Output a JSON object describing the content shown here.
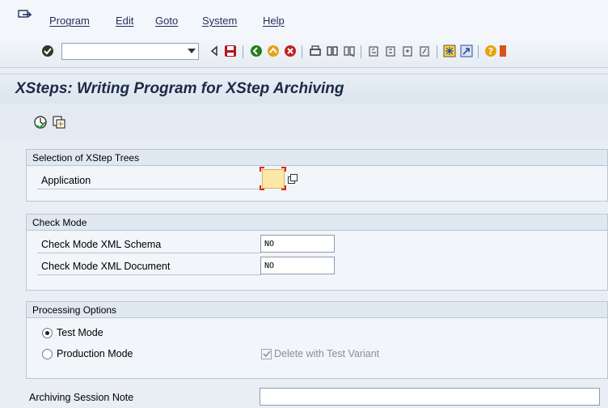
{
  "menu": {
    "items": [
      {
        "label": "Program"
      },
      {
        "label": "Edit"
      },
      {
        "label": "Goto"
      },
      {
        "label": "System"
      },
      {
        "label": "Help"
      }
    ]
  },
  "toolbar": {
    "command_value": "",
    "icons": [
      "enter-icon",
      "back-icon",
      "save-icon",
      "back-nav-icon",
      "exit-icon",
      "cancel-icon",
      "print-icon",
      "find-icon",
      "find-next-icon",
      "first-page-icon",
      "previous-page-icon",
      "next-page-icon",
      "last-page-icon",
      "create-session-icon",
      "shortcut-icon",
      "help-icon",
      "customize-layout-icon"
    ]
  },
  "title": {
    "text": "XSteps: Writing Program for XStep Archiving"
  },
  "app_toolbar": {
    "icons": [
      "execute-icon",
      "get-variant-icon"
    ]
  },
  "selection_frame": {
    "heading": "Selection of XStep Trees",
    "application_label": "Application",
    "application_value": ""
  },
  "check_mode_frame": {
    "heading": "Check Mode",
    "schema_label": "Check Mode XML Schema",
    "schema_value": "NO",
    "document_label": "Check Mode XML Document",
    "document_value": "NO"
  },
  "processing_frame": {
    "heading": "Processing Options",
    "test_mode_label": "Test Mode",
    "test_mode_selected": true,
    "production_mode_label": "Production Mode",
    "production_mode_selected": false,
    "delete_variant_label": "Delete with Test Variant",
    "delete_variant_checked": true
  },
  "note": {
    "label": "Archiving Session Note",
    "value": ""
  },
  "colors": {
    "background": "#e9eef4",
    "title_text": "#1b2a44",
    "required_field": "#fde8a6",
    "required_marker": "#d9261c"
  }
}
